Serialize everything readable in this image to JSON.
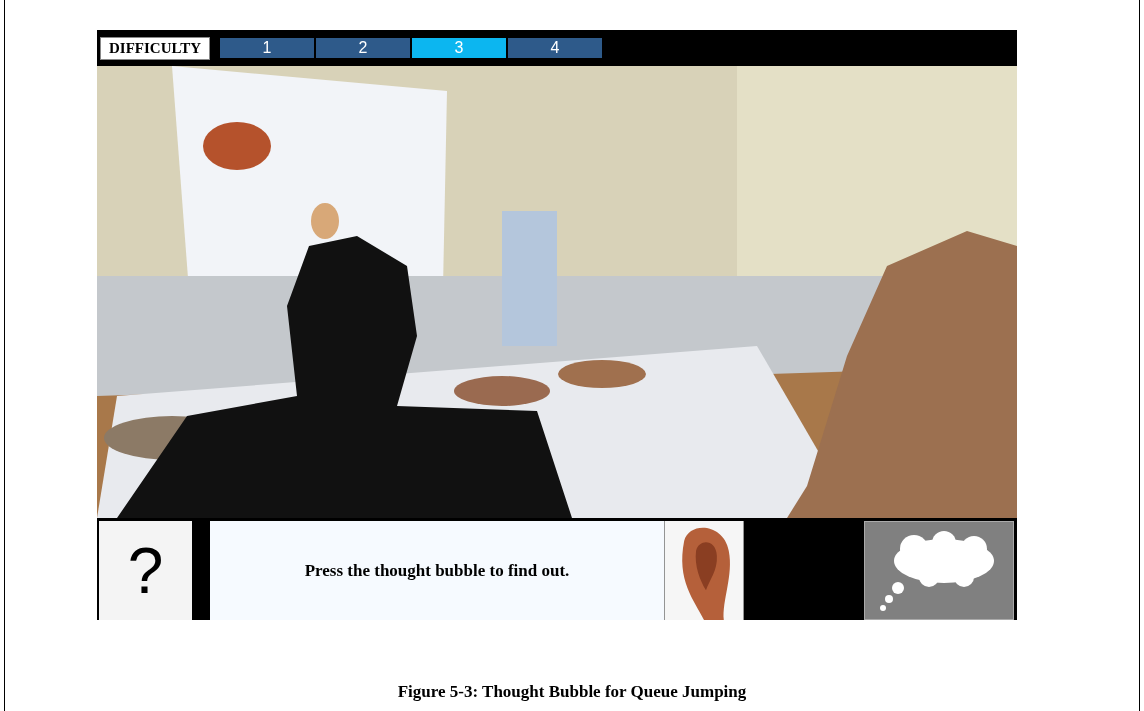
{
  "toolbar": {
    "label": "DIFFICULTY",
    "levels": [
      {
        "label": "1",
        "selected": false
      },
      {
        "label": "2",
        "selected": false
      },
      {
        "label": "3",
        "selected": true
      },
      {
        "label": "4",
        "selected": false
      }
    ]
  },
  "bottom_bar": {
    "help_button": "?",
    "message": "Press the thought bubble to find out."
  },
  "caption": "Figure 5-3: Thought Bubble for Queue Jumping"
}
